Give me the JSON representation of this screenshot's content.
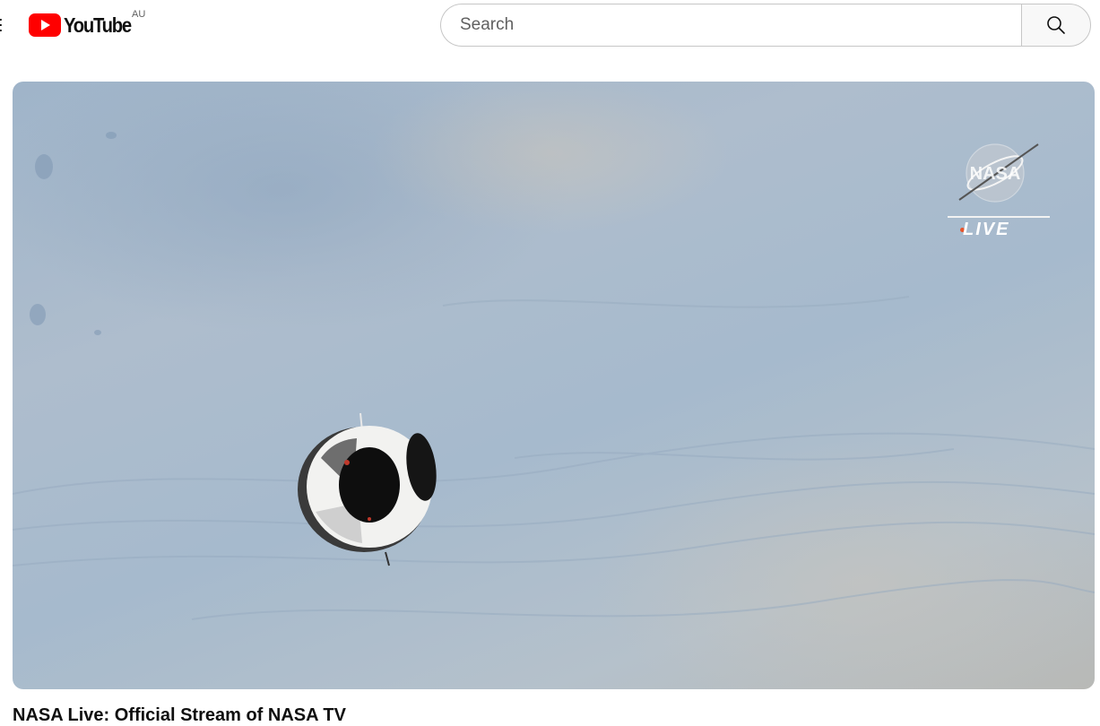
{
  "header": {
    "logo_text": "YouTube",
    "country_code": "AU",
    "search": {
      "placeholder": "Search",
      "value": ""
    }
  },
  "player": {
    "watermark": {
      "logo_text": "NASA",
      "live_label": "LIVE",
      "live_dot_color": "#e8542a"
    }
  },
  "video": {
    "title": "NASA Live: Official Stream of NASA TV"
  },
  "colors": {
    "youtube_red": "#ff0000",
    "text": "#0f0f0f",
    "secondary_text": "#606060"
  }
}
